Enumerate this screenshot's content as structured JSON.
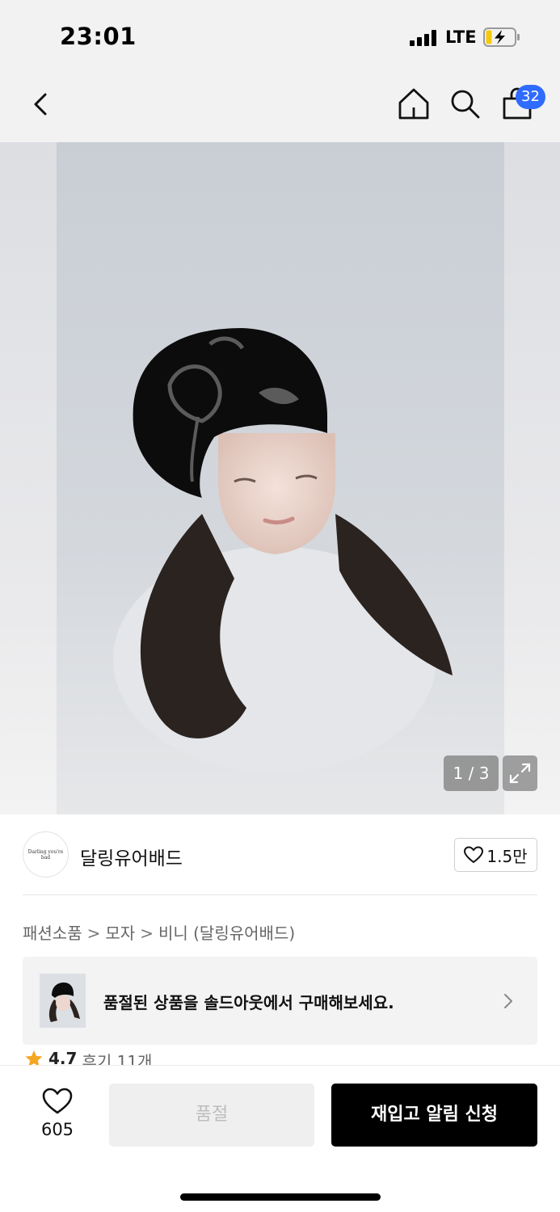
{
  "status_bar": {
    "time": "23:01",
    "network": "LTE",
    "icons": [
      "cellular-signal-icon",
      "battery-charging-icon"
    ]
  },
  "nav": {
    "icons": [
      "back-chevron-icon",
      "home-icon",
      "search-icon",
      "shopping-bag-icon"
    ],
    "cart_count": "32",
    "badge_color": "#2f6bff"
  },
  "gallery": {
    "counter": "1 / 3",
    "expand_icon": "expand-arrows-icon"
  },
  "brand": {
    "logo_text": "Darling you're bad",
    "name": "달링유어배드",
    "likes": "1.5만",
    "heart_icon": "heart-outline-icon"
  },
  "breadcrumb": [
    "패션소품",
    "모자",
    "비니 (달링유어배드)"
  ],
  "breadcrumb_separator": ">",
  "soldout_banner": {
    "text": "품절된 상품을 솔드아웃에서 구매해보세요.",
    "chevron_icon": "chevron-right-icon"
  },
  "rating": {
    "score": "4.7",
    "reviews": "후기 11개",
    "star_color": "#f5a623"
  },
  "bottom_bar": {
    "wish_count": "605",
    "soldout_label": "품절",
    "restock_label": "재입고 알림 신청"
  }
}
